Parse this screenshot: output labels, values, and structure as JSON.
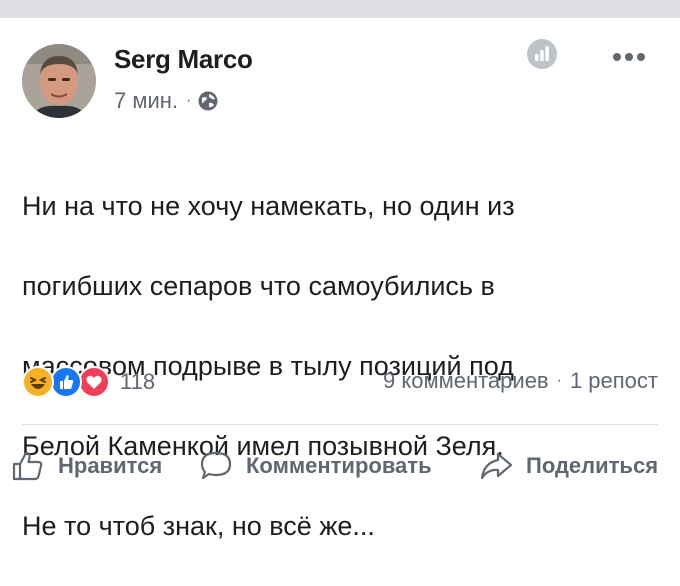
{
  "post": {
    "author": "Serg Marco",
    "time": "7 мин.",
    "time_separator": "·",
    "text_lines": [
      "Ни на что не хочу намекать, но один из",
      "погибших сепаров что самоубились в",
      "массовом подрыве в тылу позиций под",
      "Белой Каменкой имел позывной Зеля.",
      "Не то чтоб знак, но всё же..."
    ]
  },
  "reactions": {
    "icons": [
      "haha-icon",
      "like-icon",
      "love-icon"
    ],
    "count": "118",
    "colors": {
      "haha": "#f7b125",
      "like": "#1877f2",
      "love": "#f33e58"
    }
  },
  "engagement": {
    "comments": "9 комментариев",
    "separator": "·",
    "shares": "1 репост"
  },
  "actions": {
    "like": "Нравится",
    "comment": "Комментировать",
    "share": "Поделиться"
  }
}
